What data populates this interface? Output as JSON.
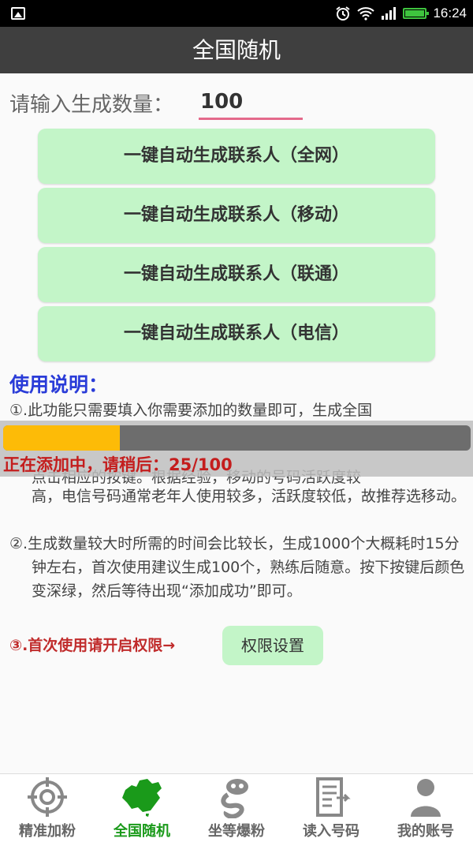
{
  "status_bar": {
    "time": "16:24"
  },
  "title": "全国随机",
  "quantity": {
    "label": "请输入生成数量：",
    "value": "100"
  },
  "buttons": [
    "一键自动生成联系人（全网）",
    "一键自动生成联系人（移动）",
    "一键自动生成联系人（联通）",
    "一键自动生成联系人（电信）"
  ],
  "instructions": {
    "title": "使用说明：",
    "item1_top": "①.此功能只需要填入你需要添加的数量即可，生成全国",
    "item1_partial": "点击相应的按键。根据经验，移动的号码活跃度较",
    "item1_rest": "高，电信号码通常老年人使用较多，活跃度较低，故推荐选移动。",
    "item2": "②.生成数量较大时所需的时间会比较长，生成1000个大概耗时15分钟左右，首次使用建议生成100个，熟练后随意。按下按键后颜色变深绿，然后等待出现“添加成功”即可。",
    "item3_label": "③.首次使用请开启权限→",
    "permission_button": "权限设置"
  },
  "progress": {
    "text": "正在添加中，请稍后：25/100",
    "current": 25,
    "total": 100,
    "fill_color": "#fdbb07"
  },
  "nav": [
    {
      "label": "精准加粉",
      "icon": "target-icon",
      "active": false
    },
    {
      "label": "全国随机",
      "icon": "china-map-icon",
      "active": true
    },
    {
      "label": "坐等爆粉",
      "icon": "mascot-icon",
      "active": false
    },
    {
      "label": "读入号码",
      "icon": "import-document-icon",
      "active": false
    },
    {
      "label": "我的账号",
      "icon": "user-icon",
      "active": false
    }
  ],
  "colors": {
    "accent_green": "#1a9a1a",
    "button_bg": "#c3f5c8",
    "input_underline": "#e46a8b",
    "instructions_title": "#2a3cd8",
    "warning_red": "#c41d1d"
  }
}
